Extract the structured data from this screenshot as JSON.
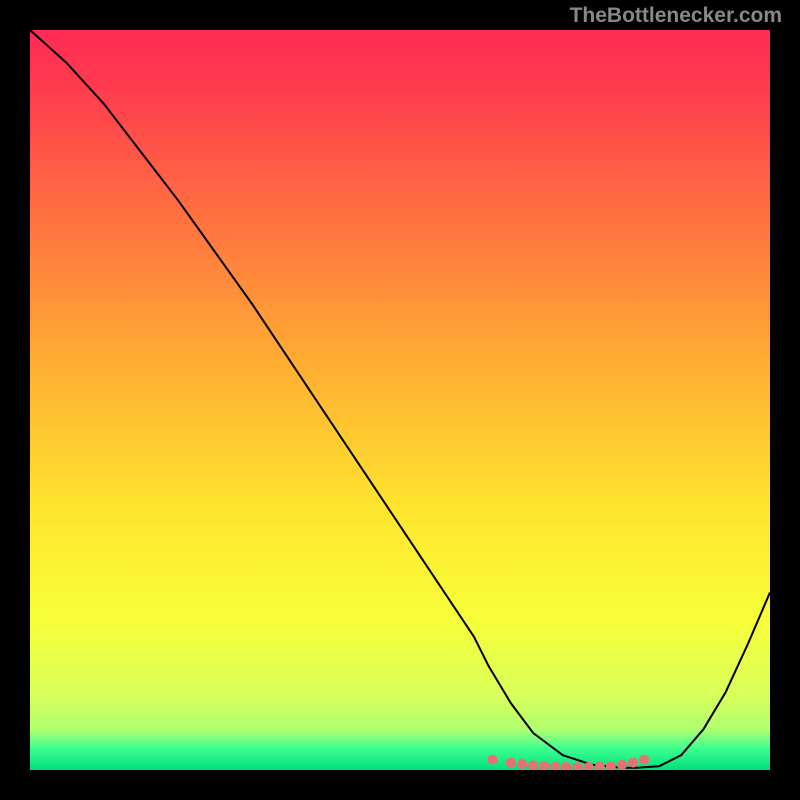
{
  "watermark": "TheBottlenecker.com",
  "chart_data": {
    "type": "line",
    "title": "",
    "xlabel": "",
    "ylabel": "",
    "xlim": [
      0,
      100
    ],
    "ylim": [
      0,
      100
    ],
    "gradient_stops": [
      {
        "offset": 0.0,
        "color": "#ff2a55"
      },
      {
        "offset": 0.08,
        "color": "#ff3c4e"
      },
      {
        "offset": 0.25,
        "color": "#ff7040"
      },
      {
        "offset": 0.45,
        "color": "#ffad33"
      },
      {
        "offset": 0.65,
        "color": "#ffe62e"
      },
      {
        "offset": 0.8,
        "color": "#f7ff3a"
      },
      {
        "offset": 0.9,
        "color": "#d8ff5a"
      },
      {
        "offset": 0.945,
        "color": "#b0ff70"
      },
      {
        "offset": 0.97,
        "color": "#40ff90"
      },
      {
        "offset": 1.0,
        "color": "#00e080"
      }
    ],
    "curve": {
      "x": [
        0,
        5,
        10,
        15,
        20,
        25,
        30,
        35,
        40,
        45,
        50,
        55,
        60,
        62,
        65,
        68,
        72,
        76,
        80,
        82,
        85,
        88,
        91,
        94,
        97,
        100
      ],
      "y": [
        100,
        95.5,
        90,
        83.5,
        77,
        70,
        63,
        55.5,
        48,
        40.5,
        33,
        25.5,
        18,
        14,
        9,
        5,
        2,
        0.7,
        0.3,
        0.3,
        0.5,
        2,
        5.5,
        10.5,
        17,
        24
      ]
    },
    "markers": {
      "x": [
        62.5,
        65,
        66.5,
        68,
        69.5,
        71,
        72.5,
        74,
        75.5,
        77,
        78.5,
        80,
        81.5,
        83
      ],
      "y": [
        1.4,
        1.0,
        0.8,
        0.6,
        0.5,
        0.45,
        0.4,
        0.4,
        0.4,
        0.45,
        0.5,
        0.7,
        1.0,
        1.4
      ],
      "color": "#e87070",
      "radius": 5
    }
  }
}
